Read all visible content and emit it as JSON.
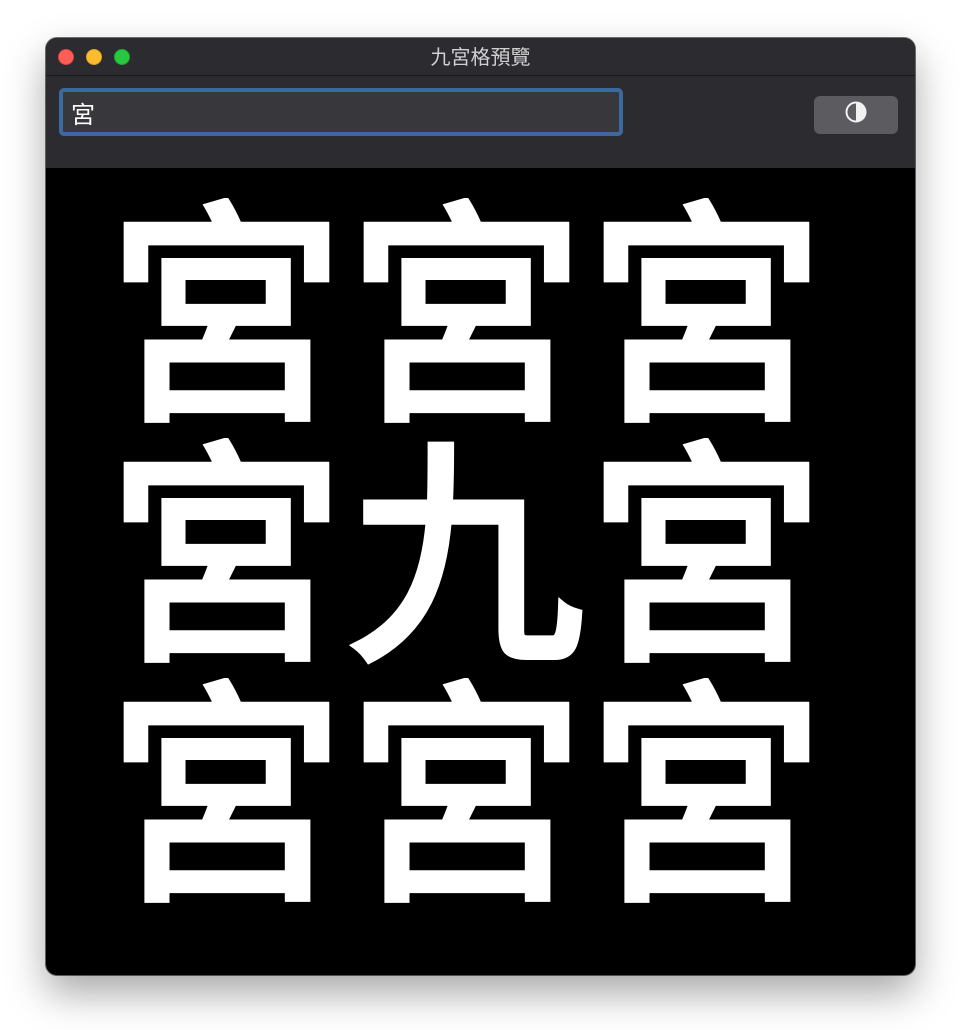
{
  "window": {
    "title": "九宮格預覽"
  },
  "toolbar": {
    "input_value": "宮",
    "contrast_icon": "half-circle-contrast-icon"
  },
  "grid": {
    "cells": [
      "宮",
      "宮",
      "宮",
      "宮",
      "九",
      "宮",
      "宮",
      "宮",
      "宮"
    ]
  },
  "colors": {
    "background": "#000000",
    "glyph": "#ffffff",
    "chrome": "#2c2b30",
    "focus_ring": "#3c6aa0",
    "close": "#ff5f57",
    "minimize": "#febc2e",
    "maximize": "#28c840"
  }
}
